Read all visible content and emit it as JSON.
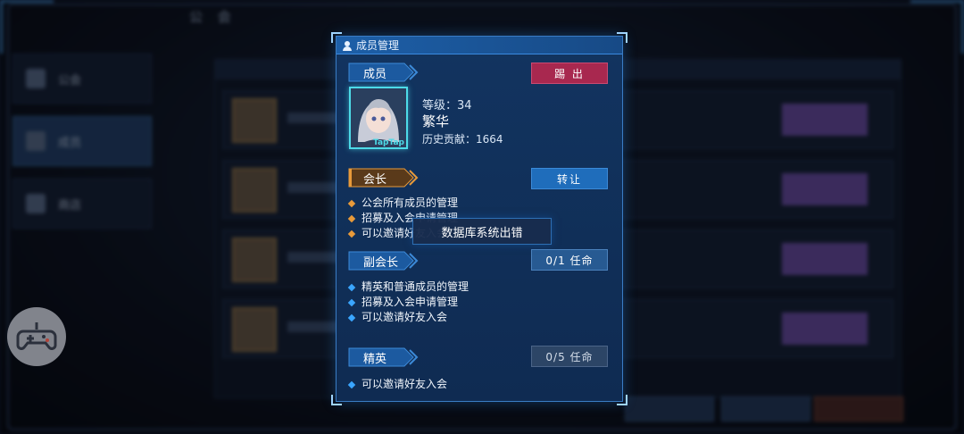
{
  "background": {
    "title": "公 会",
    "sidebar": [
      "公会",
      "成员",
      "商店"
    ]
  },
  "panel": {
    "header_title": "成员管理",
    "member_tab": "成员",
    "kick_label": "踢 出",
    "level_label": "等级：34",
    "member_name": "繁华",
    "contribution_label": "历史贡献：1664",
    "avatar_watermark": "TapTap",
    "president": {
      "tab": "会长",
      "action": "转让",
      "perms": [
        "公会所有成员的管理",
        "招募及入会申请管理",
        "可以邀请好友入会"
      ]
    },
    "vice_president": {
      "tab": "副会长",
      "action": "0/1 任命",
      "perms": [
        "精英和普通成员的管理",
        "招募及入会申请管理",
        "可以邀请好友入会"
      ]
    },
    "elite": {
      "tab": "精英",
      "action": "0/5 任命",
      "perms": [
        "可以邀请好友入会"
      ]
    }
  },
  "toast": {
    "message": "数据库系统出错"
  },
  "colors": {
    "panel_bg": "#123460",
    "accent_cyan": "#4ddbe8",
    "kick_red": "#a8284f",
    "president_orange": "#e89a3a",
    "member_blue": "#3aa6ff"
  },
  "icons": {
    "header": "member-icon",
    "overlay": "gamepad-icon"
  }
}
